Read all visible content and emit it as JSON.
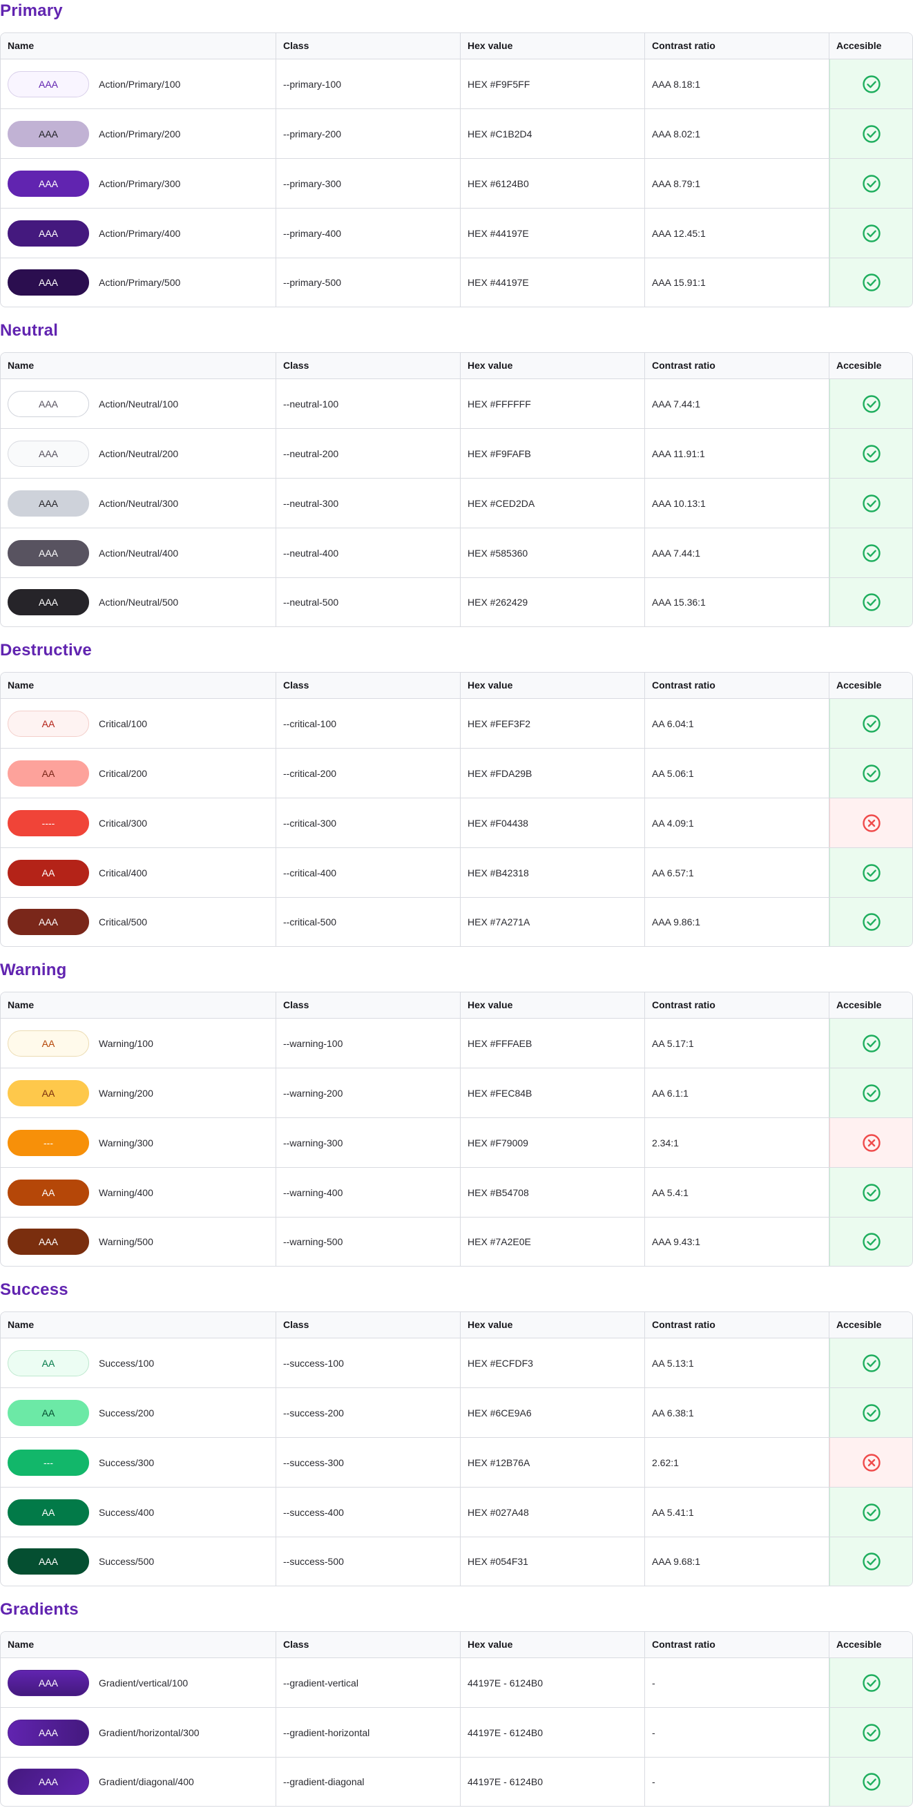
{
  "headers": {
    "name": "Name",
    "class": "Class",
    "hex": "Hex value",
    "contrast": "Contrast ratio",
    "accessible": "Accesible"
  },
  "colors": {
    "title": "#6124B0",
    "ok_icon": "#1fae5e",
    "bad_icon": "#ef4b4b"
  },
  "sections": [
    {
      "title": "Primary",
      "rows": [
        {
          "swatch_text": "AAA",
          "bg": "#F9F5FF",
          "fg": "#6124B0",
          "border": "#d9d0ea",
          "name": "Action/Primary/100",
          "class": "--primary-100",
          "hex": "HEX #F9F5FF",
          "contrast": "AAA 8.18:1",
          "accessible": true,
          "icon": "check-circle-icon"
        },
        {
          "swatch_text": "AAA",
          "bg": "#C1B2D4",
          "fg": "#1f1f24",
          "border": "#C1B2D4",
          "name": "Action/Primary/200",
          "class": "--primary-200",
          "hex": "HEX #C1B2D4",
          "contrast": "AAA 8.02:1",
          "accessible": true,
          "icon": "check-circle-icon"
        },
        {
          "swatch_text": "AAA",
          "bg": "#6124B0",
          "fg": "#ffffff",
          "border": "#6124B0",
          "name": "Action/Primary/300",
          "class": "--primary-300",
          "hex": "HEX #6124B0",
          "contrast": "AAA 8.79:1",
          "accessible": true,
          "icon": "check-circle-icon"
        },
        {
          "swatch_text": "AAA",
          "bg": "#44197E",
          "fg": "#ffffff",
          "border": "#44197E",
          "name": "Action/Primary/400",
          "class": "--primary-400",
          "hex": "HEX #44197E",
          "contrast": "AAA 12.45:1",
          "accessible": true,
          "icon": "check-circle-icon"
        },
        {
          "swatch_text": "AAA",
          "bg": "#2B0E4F",
          "fg": "#ffffff",
          "border": "#2B0E4F",
          "name": "Action/Primary/500",
          "class": "--primary-500",
          "hex": "HEX #44197E",
          "contrast": "AAA 15.91:1",
          "accessible": true,
          "icon": "check-circle-icon"
        }
      ]
    },
    {
      "title": "Neutral",
      "rows": [
        {
          "swatch_text": "AAA",
          "bg": "#FFFFFF",
          "fg": "#585360",
          "border": "#cfd2da",
          "name": "Action/Neutral/100",
          "class": "--neutral-100",
          "hex": "HEX #FFFFFF",
          "contrast": "AAA 7.44:1",
          "accessible": true,
          "icon": "check-circle-icon"
        },
        {
          "swatch_text": "AAA",
          "bg": "#F9FAFB",
          "fg": "#585360",
          "border": "#d9dbe1",
          "name": "Action/Neutral/200",
          "class": "--neutral-200",
          "hex": "HEX #F9FAFB",
          "contrast": "AAA 11.91:1",
          "accessible": true,
          "icon": "check-circle-icon"
        },
        {
          "swatch_text": "AAA",
          "bg": "#CED2DA",
          "fg": "#262429",
          "border": "#CED2DA",
          "name": "Action/Neutral/300",
          "class": "--neutral-300",
          "hex": "HEX #CED2DA",
          "contrast": "AAA 10.13:1",
          "accessible": true,
          "icon": "check-circle-icon"
        },
        {
          "swatch_text": "AAA",
          "bg": "#585360",
          "fg": "#ffffff",
          "border": "#585360",
          "name": "Action/Neutral/400",
          "class": "--neutral-400",
          "hex": "HEX #585360",
          "contrast": "AAA 7.44:1",
          "accessible": true,
          "icon": "check-circle-icon"
        },
        {
          "swatch_text": "AAA",
          "bg": "#262429",
          "fg": "#ffffff",
          "border": "#262429",
          "name": "Action/Neutral/500",
          "class": "--neutral-500",
          "hex": "HEX #262429",
          "contrast": "AAA 15.36:1",
          "accessible": true,
          "icon": "check-circle-icon"
        }
      ]
    },
    {
      "title": "Destructive",
      "rows": [
        {
          "swatch_text": "AA",
          "bg": "#FEF3F2",
          "fg": "#B42318",
          "border": "#f3cfcb",
          "name": "Critical/100",
          "class": "--critical-100",
          "hex": "HEX #FEF3F2",
          "contrast": "AA 6.04:1",
          "accessible": true,
          "icon": "check-circle-icon"
        },
        {
          "swatch_text": "AA",
          "bg": "#FDA29B",
          "fg": "#7A271A",
          "border": "#FDA29B",
          "name": "Critical/200",
          "class": "--critical-200",
          "hex": "HEX #FDA29B",
          "contrast": "AA 5.06:1",
          "accessible": true,
          "icon": "check-circle-icon"
        },
        {
          "swatch_text": "----",
          "bg": "#F04438",
          "fg": "#ffffff",
          "border": "#F04438",
          "name": "Critical/300",
          "class": "--critical-300",
          "hex": "HEX #F04438",
          "contrast": "AA 4.09:1",
          "accessible": false,
          "icon": "x-circle-icon"
        },
        {
          "swatch_text": "AA",
          "bg": "#B42318",
          "fg": "#ffffff",
          "border": "#B42318",
          "name": "Critical/400",
          "class": "--critical-400",
          "hex": "HEX #B42318",
          "contrast": "AA 6.57:1",
          "accessible": true,
          "icon": "check-circle-icon"
        },
        {
          "swatch_text": "AAA",
          "bg": "#7A271A",
          "fg": "#ffffff",
          "border": "#7A271A",
          "name": "Critical/500",
          "class": "--critical-500",
          "hex": "HEX #7A271A",
          "contrast": "AAA 9.86:1",
          "accessible": true,
          "icon": "check-circle-icon"
        }
      ]
    },
    {
      "title": "Warning",
      "rows": [
        {
          "swatch_text": "AA",
          "bg": "#FFFAEB",
          "fg": "#B54708",
          "border": "#ecdcb3",
          "name": "Warning/100",
          "class": "--warning-100",
          "hex": "HEX #FFFAEB",
          "contrast": "AA 5.17:1",
          "accessible": true,
          "icon": "check-circle-icon"
        },
        {
          "swatch_text": "AA",
          "bg": "#FEC84B",
          "fg": "#7A2E0E",
          "border": "#FEC84B",
          "name": "Warning/200",
          "class": "--warning-200",
          "hex": "HEX #FEC84B",
          "contrast": "AA 6.1:1",
          "accessible": true,
          "icon": "check-circle-icon"
        },
        {
          "swatch_text": "---",
          "bg": "#F79009",
          "fg": "#ffffff",
          "border": "#F79009",
          "name": "Warning/300",
          "class": "--warning-300",
          "hex": "HEX #F79009",
          "contrast": "2.34:1",
          "accessible": false,
          "icon": "x-circle-icon"
        },
        {
          "swatch_text": "AA",
          "bg": "#B54708",
          "fg": "#ffffff",
          "border": "#B54708",
          "name": "Warning/400",
          "class": "--warning-400",
          "hex": "HEX #B54708",
          "contrast": "AA 5.4:1",
          "accessible": true,
          "icon": "check-circle-icon"
        },
        {
          "swatch_text": "AAA",
          "bg": "#7A2E0E",
          "fg": "#ffffff",
          "border": "#7A2E0E",
          "name": "Warning/500",
          "class": "--warning-500",
          "hex": "HEX #7A2E0E",
          "contrast": "AAA 9.43:1",
          "accessible": true,
          "icon": "check-circle-icon"
        }
      ]
    },
    {
      "title": "Success",
      "rows": [
        {
          "swatch_text": "AA",
          "bg": "#ECFDF3",
          "fg": "#027A48",
          "border": "#bfe8cf",
          "name": "Success/100",
          "class": "--success-100",
          "hex": "HEX #ECFDF3",
          "contrast": "AA 5.13:1",
          "accessible": true,
          "icon": "check-circle-icon"
        },
        {
          "swatch_text": "AA",
          "bg": "#6CE9A6",
          "fg": "#054F31",
          "border": "#6CE9A6",
          "name": "Success/200",
          "class": "--success-200",
          "hex": "HEX #6CE9A6",
          "contrast": "AA 6.38:1",
          "accessible": true,
          "icon": "check-circle-icon"
        },
        {
          "swatch_text": "---",
          "bg": "#12B76A",
          "fg": "#ffffff",
          "border": "#12B76A",
          "name": "Success/300",
          "class": "--success-300",
          "hex": "HEX #12B76A",
          "contrast": "2.62:1",
          "accessible": false,
          "icon": "x-circle-icon"
        },
        {
          "swatch_text": "AA",
          "bg": "#027A48",
          "fg": "#ffffff",
          "border": "#027A48",
          "name": "Success/400",
          "class": "--success-400",
          "hex": "HEX #027A48",
          "contrast": "AA 5.41:1",
          "accessible": true,
          "icon": "check-circle-icon"
        },
        {
          "swatch_text": "AAA",
          "bg": "#054F31",
          "fg": "#ffffff",
          "border": "#054F31",
          "name": "Success/500",
          "class": "--success-500",
          "hex": "HEX #054F31",
          "contrast": "AAA 9.68:1",
          "accessible": true,
          "icon": "check-circle-icon"
        }
      ]
    },
    {
      "title": "Gradients",
      "rows": [
        {
          "swatch_text": "AAA",
          "bg": "linear-gradient(180deg, #6124B0, #44197E)",
          "fg": "#ffffff",
          "border": "#50208f",
          "name": "Gradient/vertical/100",
          "class": "--gradient-vertical",
          "hex": "44197E - 6124B0",
          "contrast": "-",
          "accessible": true,
          "icon": "check-circle-icon"
        },
        {
          "swatch_text": "AAA",
          "bg": "linear-gradient(90deg, #6124B0, #44197E)",
          "fg": "#ffffff",
          "border": "#50208f",
          "name": "Gradient/horizontal/300",
          "class": "--gradient-horizontal",
          "hex": "44197E - 6124B0",
          "contrast": "-",
          "accessible": true,
          "icon": "check-circle-icon"
        },
        {
          "swatch_text": "AAA",
          "bg": "linear-gradient(135deg, #44197E, #6124B0)",
          "fg": "#ffffff",
          "border": "#50208f",
          "name": "Gradient/diagonal/400",
          "class": "--gradient-diagonal",
          "hex": "44197E - 6124B0",
          "contrast": "-",
          "accessible": true,
          "icon": "check-circle-icon"
        }
      ]
    }
  ]
}
